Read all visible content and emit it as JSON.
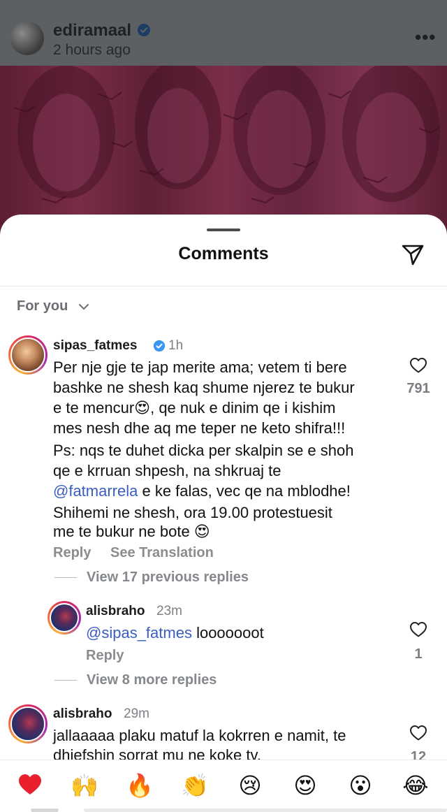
{
  "post": {
    "username": "ediramaal",
    "time": "2 hours ago",
    "more": "•••"
  },
  "sheet": {
    "title": "Comments",
    "filter": "For you"
  },
  "comments": [
    {
      "username": "sipas_fatmes",
      "verified": true,
      "time": "1h",
      "lines": [
        "Per nje gje te jap merite ama; vetem ti bere",
        "bashke ne shesh kaq shume njerez te bukur",
        "e te mencur😍, qe nuk e dinim qe i kishim",
        "mes nesh dhe aq me teper ne keto shifra!!!",
        "Ps: nqs te duhet dicka per skalpin se e shoh",
        "qe e krruan shpesh, na shkruaj te",
        "@fatmarrela",
        " e ke falas, vec qe na mblodhe!",
        "Shihemi ne shesh, ora 19.00 protestuesit",
        "me te bukur ne bote 😍"
      ],
      "reply": "Reply",
      "see_translation": "See Translation",
      "likes": "791",
      "view_replies": "View 17 previous replies"
    },
    {
      "username": "alisbraho",
      "time": "23m",
      "mention": "@sipas_fatmes",
      "text": " looooooot",
      "reply": "Reply",
      "likes": "1",
      "view_replies": "View 8 more replies"
    },
    {
      "username": "alisbraho",
      "time": "29m",
      "lines": [
        "jallaaaaa plaku matuf la kokrren e namit, te",
        "dhiefshin sorrat mu ne koke tv."
      ],
      "likes": "12"
    }
  ],
  "emoji_bar": [
    "❤️",
    "🙌",
    "🔥",
    "👏",
    "😢",
    "😍",
    "😮",
    "😂"
  ],
  "colors": {
    "mention": "#3a5ebf",
    "verified": "#3897f0",
    "muted": "#8a8c90"
  }
}
